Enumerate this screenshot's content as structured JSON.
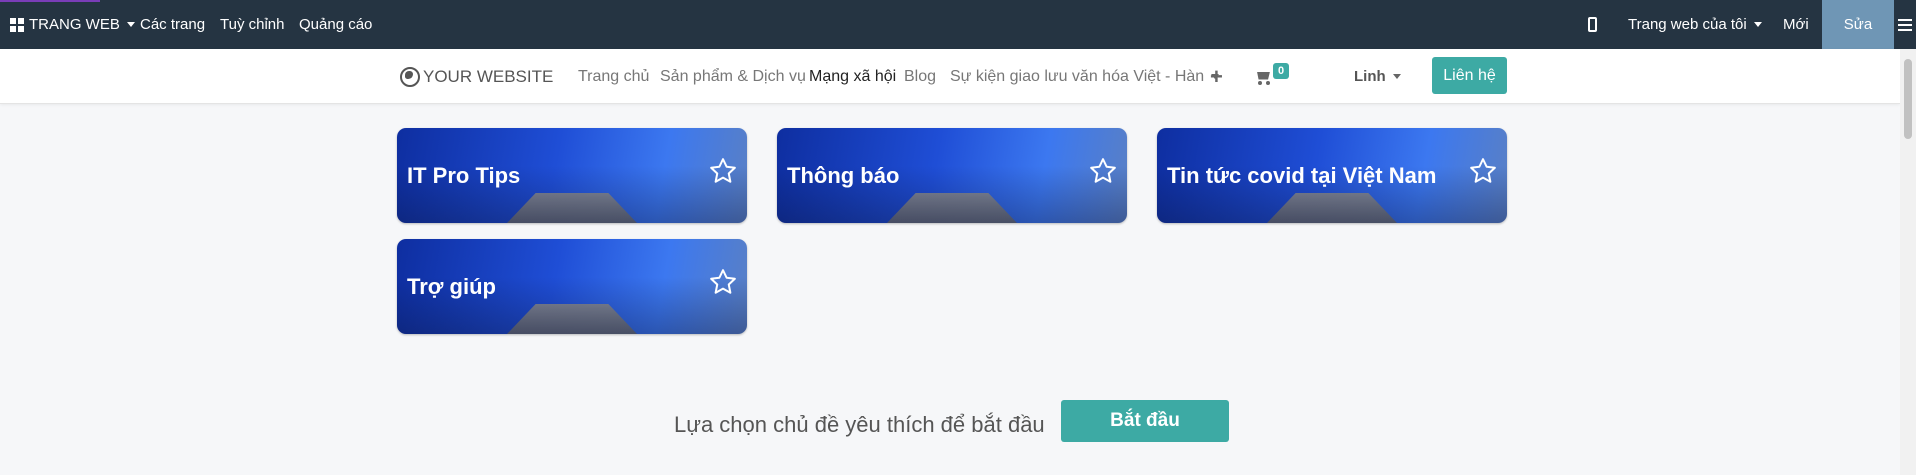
{
  "admin_bar": {
    "app_label": "TRANG WEB",
    "menu": [
      "Các trang",
      "Tuỳ chỉnh",
      "Quảng cáo"
    ],
    "website_selector": "Trang web của tôi",
    "new_label": "Mới",
    "edit_label": "Sửa"
  },
  "navbar": {
    "logo_text": "YOUR WEBSITE",
    "items": [
      "Trang chủ",
      "Sản phẩm & Dịch vụ",
      "Mạng xã hội",
      "Blog",
      "Sự kiện giao lưu văn hóa Việt - Hàn"
    ],
    "active_item": "Mạng xã hội",
    "cart_count": "0",
    "user_name": "Linh",
    "contact_label": "Liên hệ"
  },
  "topics": [
    {
      "title": "IT Pro Tips"
    },
    {
      "title": "Thông báo"
    },
    {
      "title": "Tin tức covid tại Việt Nam"
    },
    {
      "title": "Trợ giúp"
    }
  ],
  "cta": {
    "text": "Lựa chọn chủ đề yêu thích để bắt đầu",
    "button_label": "Bắt đầu"
  },
  "colors": {
    "admin_bar_bg": "#253442",
    "edit_bg": "#6f96b5",
    "accent": "#3daaa4",
    "card_blue": "#1f4ed6"
  }
}
